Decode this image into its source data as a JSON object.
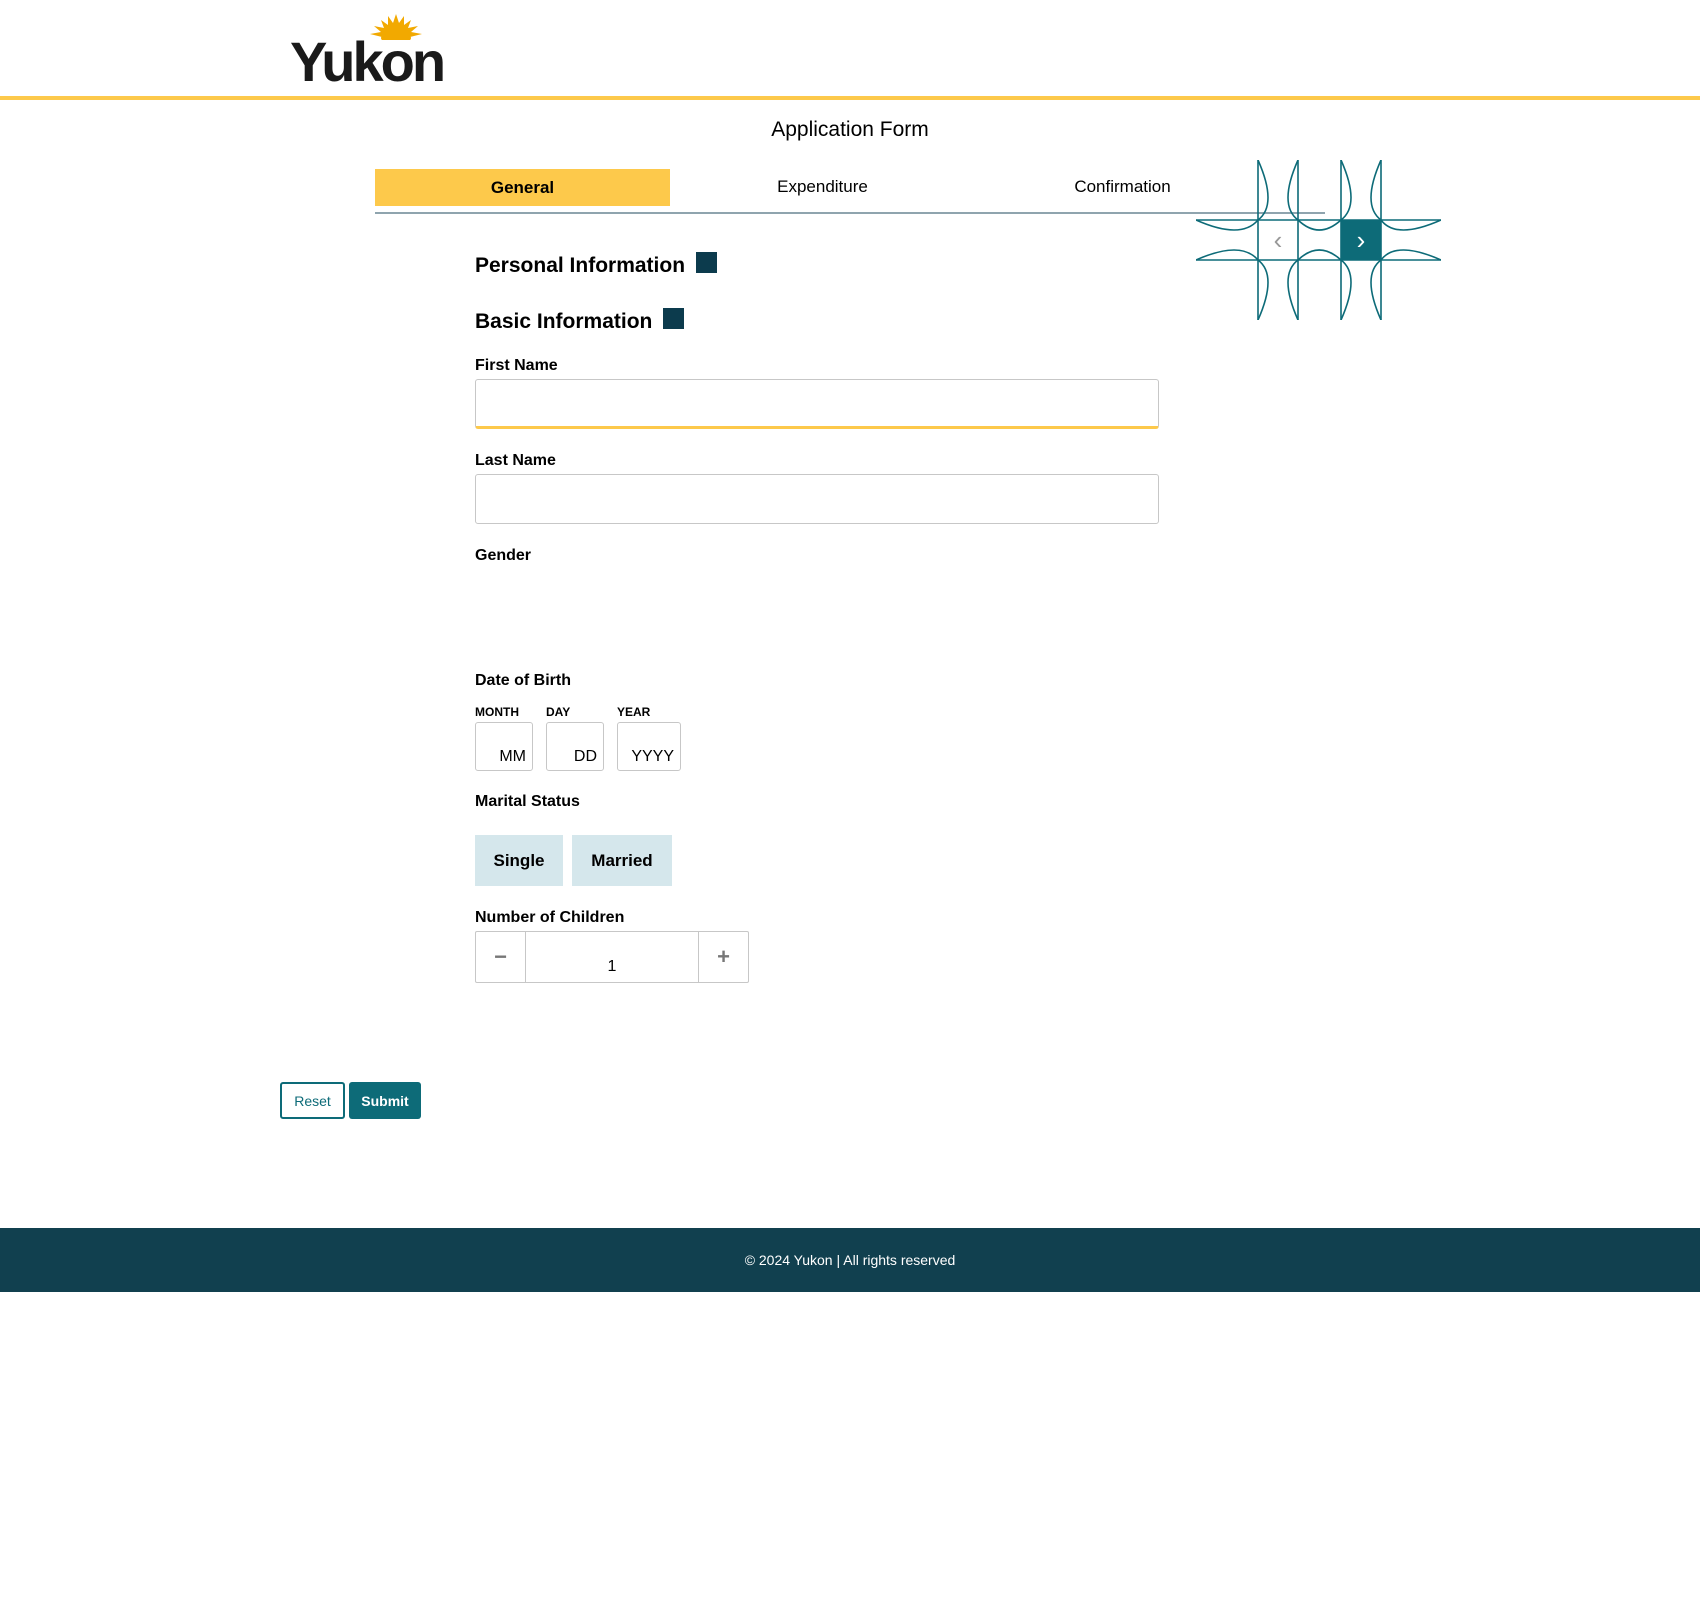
{
  "header": {
    "logo_text": "Yukon"
  },
  "page_title": "Application Form",
  "tabs": [
    {
      "label": "General",
      "active": true
    },
    {
      "label": "Expenditure",
      "active": false
    },
    {
      "label": "Confirmation",
      "active": false
    }
  ],
  "carousel": {
    "prev_icon": "chevron-left-icon",
    "next_icon": "chevron-right-icon"
  },
  "sections": {
    "personal": "Personal Information",
    "basic": "Basic Information"
  },
  "fields": {
    "first_name": {
      "label": "First Name",
      "value": ""
    },
    "last_name": {
      "label": "Last Name",
      "value": ""
    },
    "gender": {
      "label": "Gender"
    },
    "dob": {
      "label": "Date of Birth",
      "month_label": "MONTH",
      "month_value": "MM",
      "day_label": "DAY",
      "day_value": "DD",
      "year_label": "YEAR",
      "year_value": "YYYY"
    },
    "marital": {
      "label": "Marital Status",
      "options": [
        "Single",
        "Married"
      ]
    },
    "children": {
      "label": "Number of Children",
      "value": "1",
      "minus": "−",
      "plus": "+"
    }
  },
  "actions": {
    "reset": "Reset",
    "submit": "Submit"
  },
  "footer": {
    "text": "© 2024 Yukon | All rights reserved"
  },
  "colors": {
    "accent": "#fdc94b",
    "primary": "#0d6b78",
    "footer_bg": "#11404f",
    "marital_bg": "#d5e7ec"
  }
}
